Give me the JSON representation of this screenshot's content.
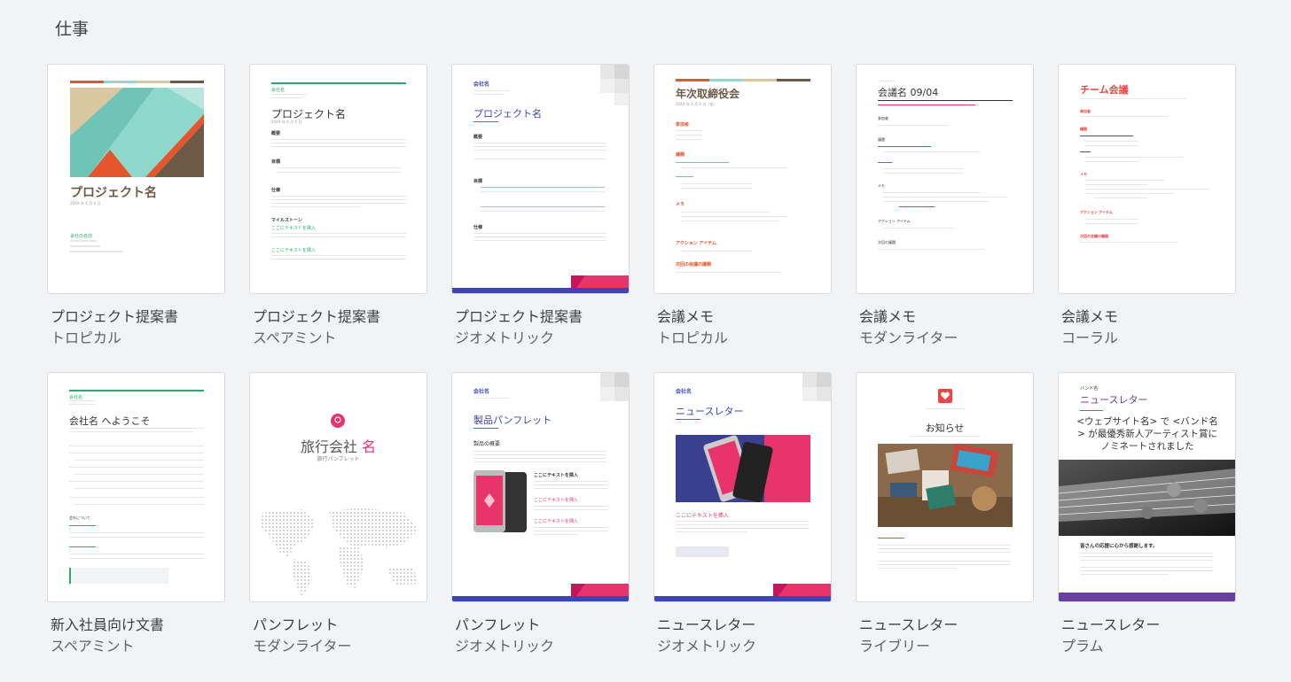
{
  "section": {
    "title": "仕事"
  },
  "templates": [
    {
      "name": "プロジェクト提案書",
      "style": "トロピカル",
      "preview": {
        "title": "プロジェクト名",
        "date": "20XX 年 X 月 X 日",
        "company": "会社の名前"
      }
    },
    {
      "name": "プロジェクト提案書",
      "style": "スペアミント",
      "preview": {
        "company": "会社名",
        "title": "プロジェクト名",
        "date": "20XX 年 X 月 X 日",
        "h1": "概要",
        "h2": "目標",
        "h3": "仕様",
        "h4": "マイルストーン",
        "link": "ここにテキストを挿入"
      }
    },
    {
      "name": "プロジェクト提案書",
      "style": "ジオメトリック",
      "preview": {
        "company": "会社名",
        "title": "プロジェクト名",
        "h1": "概要",
        "h2": "目標",
        "h3": "仕様"
      }
    },
    {
      "name": "会議メモ",
      "style": "トロピカル",
      "preview": {
        "title": "年次取締役会",
        "date": "20XX 年 X 月 X 日（金）",
        "h1": "参加者",
        "h2": "議題",
        "h3": "メモ",
        "h4": "アクション アイテム",
        "h5": "次回の会議の議題"
      }
    },
    {
      "name": "会議メモ",
      "style": "モダンライター",
      "preview": {
        "title": "会議名 09/04",
        "h1": "参加者",
        "h2": "議題",
        "h3": "メモ",
        "h4": "アクション アイテム",
        "h5": "次回の議題"
      }
    },
    {
      "name": "会議メモ",
      "style": "コーラル",
      "preview": {
        "title": "チーム会議",
        "h1": "参加者",
        "h2": "議題",
        "h3": "メモ",
        "h4": "アクション アイテム",
        "h5": "次回の会議の議題"
      }
    },
    {
      "name": "新入社員向け文書",
      "style": "スペアミント",
      "preview": {
        "company": "会社名",
        "title": "会社名 へようこそ",
        "h1": "会社について"
      }
    },
    {
      "name": "パンフレット",
      "style": "モダンライター",
      "preview": {
        "title_a": "旅行会社",
        "title_b": "名",
        "subtitle": "旅行パンフレット"
      }
    },
    {
      "name": "パンフレット",
      "style": "ジオメトリック",
      "preview": {
        "company": "会社名",
        "title": "製品パンフレット",
        "h1": "製品の概要",
        "link": "ここにテキストを挿入"
      }
    },
    {
      "name": "ニュースレター",
      "style": "ジオメトリック",
      "preview": {
        "company": "会社名",
        "title": "ニュースレター",
        "link": "ここにテキストを挿入"
      }
    },
    {
      "name": "ニュースレター",
      "style": "ライブリー",
      "preview": {
        "title": "お知らせ"
      }
    },
    {
      "name": "ニュースレター",
      "style": "プラム",
      "preview": {
        "small": "バンド名",
        "title": "ニュースレター",
        "headline": "<ウェブサイト名> で <バンド名> が最優秀新人アーティスト賞にノミネートされました",
        "caption": "皆さんの応援に心から感謝します。"
      }
    }
  ],
  "colors": {
    "mint": "#2ea86b",
    "indigo": "#3d44b3",
    "pink": "#e8336d",
    "orange": "#e4572e",
    "coral": "#ef4444",
    "plum": "#6b3fa0",
    "brown": "#6d5a46"
  }
}
